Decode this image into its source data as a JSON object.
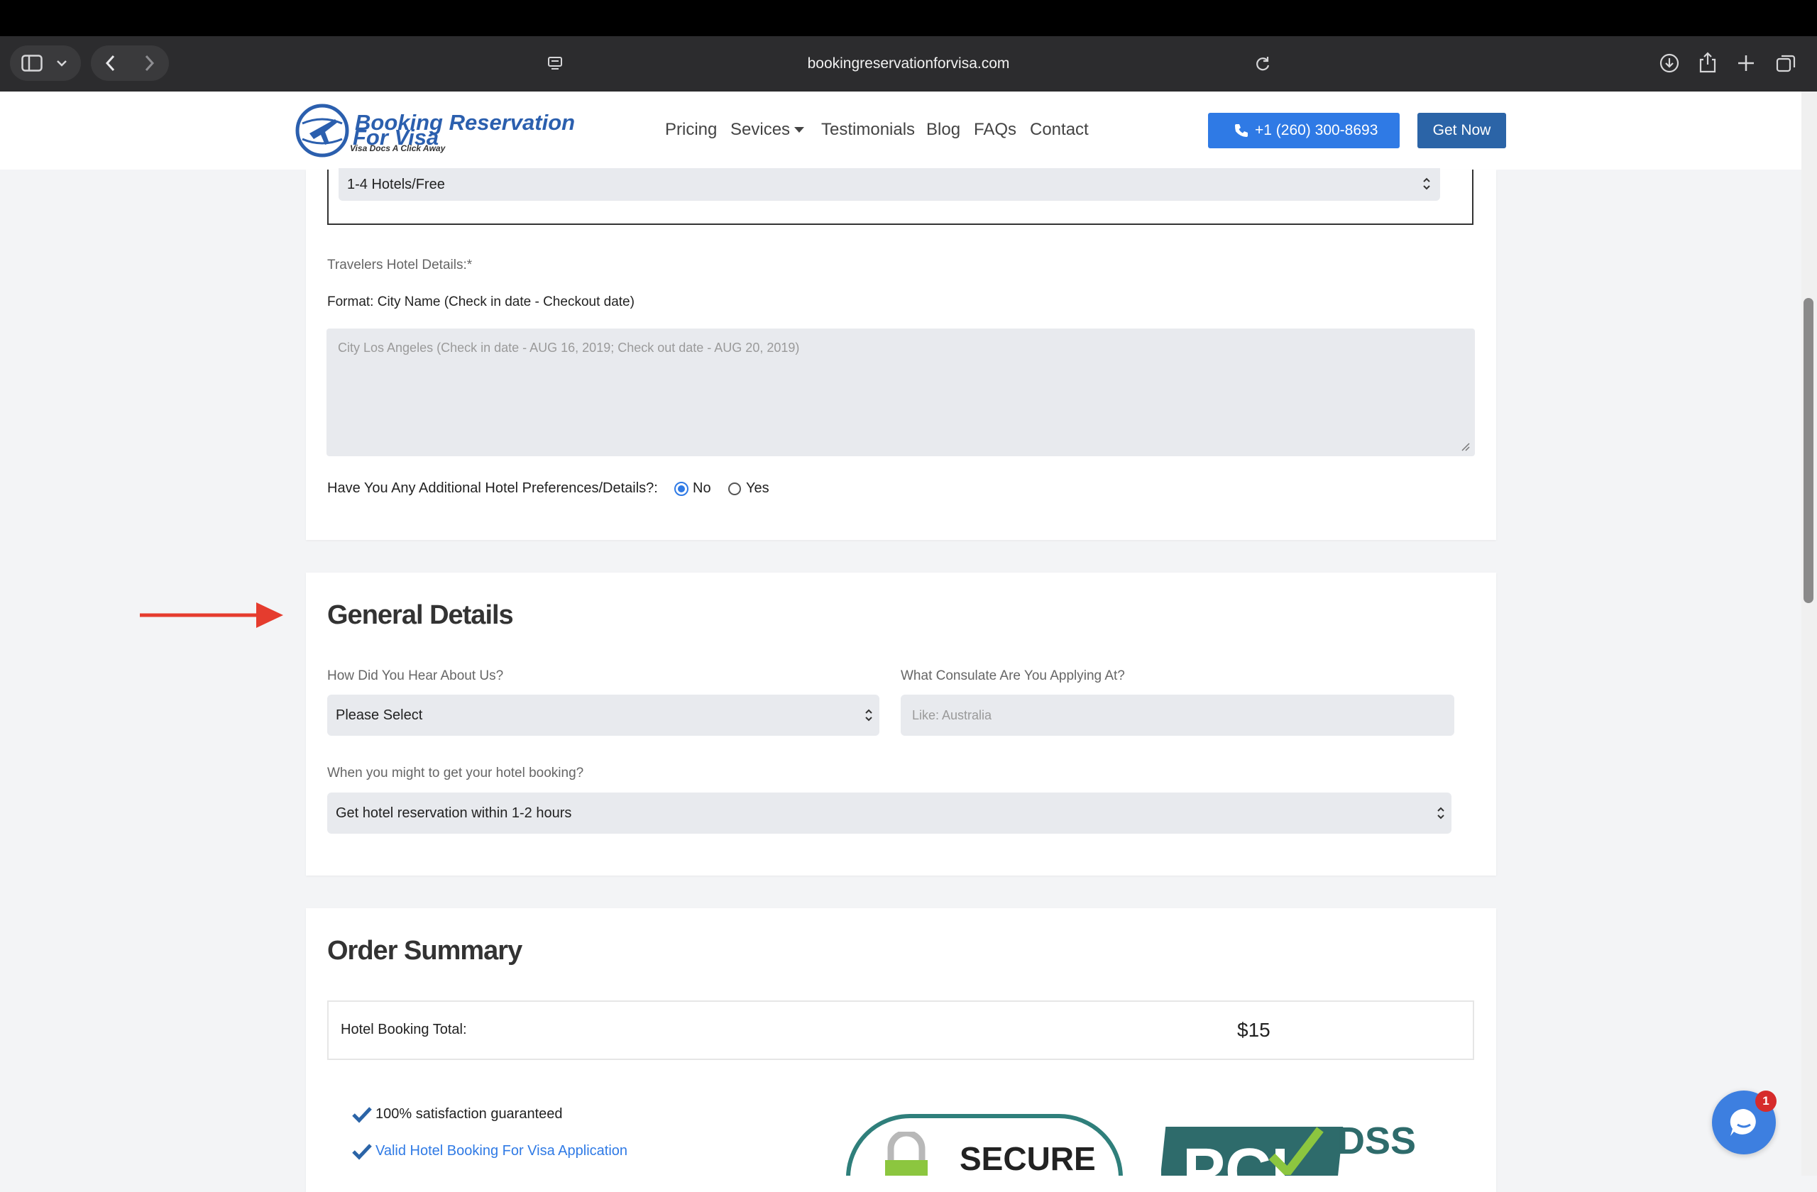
{
  "browser": {
    "url": "bookingreservationforvisa.com"
  },
  "header": {
    "logo_line1": "Booking Reservation",
    "logo_line2": "For Visa",
    "logo_tagline": "Visa Docs A Click Away",
    "nav": {
      "pricing": "Pricing",
      "services": "Sevices",
      "testimonials": "Testimonials",
      "blog": "Blog",
      "faqs": "FAQs",
      "contact": "Contact"
    },
    "phone_label": "+1 (260) 300-8693",
    "get_now_label": "Get Now"
  },
  "hotel_section": {
    "hotels_select_value": "1-4 Hotels/Free",
    "travelers_label": "Travelers Hotel Details:*",
    "format_text": "Format: City Name (Check in date - Checkout date)",
    "details_placeholder": "City Los Angeles (Check in date - AUG 16, 2019; Check out date - AUG 20, 2019)",
    "additional_prefs_question": "Have You Any Additional Hotel Preferences/Details?:",
    "option_no": "No",
    "option_yes": "Yes",
    "selected_option": "No"
  },
  "general_details": {
    "title": "General Details",
    "hear_label": "How Did You Hear About Us?",
    "hear_value": "Please Select",
    "consulate_label": "What Consulate Are You Applying At?",
    "consulate_placeholder": "Like: Australia",
    "timing_label": "When you might to get your hotel booking?",
    "timing_value": "Get hotel reservation within 1-2 hours"
  },
  "order_summary": {
    "title": "Order Summary",
    "total_label": "Hotel Booking Total:",
    "total_value": "$15",
    "benefits": [
      "100% satisfaction guaranteed",
      "Valid Hotel Booking For Visa Application"
    ],
    "badge_secure": "SECURE",
    "badge_pci_letters": "PCI",
    "badge_dss": "DSS"
  },
  "chat": {
    "unread_count": "1"
  },
  "colors": {
    "brand_blue": "#2b64a7",
    "call_blue": "#2f7ae5",
    "arrow_red": "#e53c2e",
    "chat_blue": "#3d7fe0"
  }
}
